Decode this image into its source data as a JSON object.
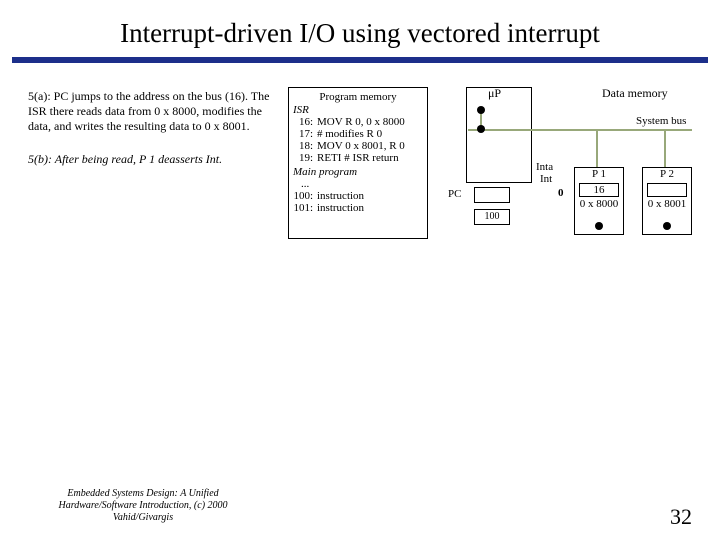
{
  "title": "Interrupt-driven I/O using vectored interrupt",
  "desc": {
    "a": "5(a): PC jumps to the address on the bus (16).  The ISR there reads data from 0 x 8000, modifies the data, and writes the resulting data to 0 x 8001.",
    "b": "5(b): After being read, P 1 deasserts Int."
  },
  "pm": {
    "title": "Program memory",
    "isr": "ISR",
    "l16n": "16:",
    "l16": "MOV R 0, 0 x 8000",
    "l17n": "17:",
    "l17": "# modifies R 0",
    "l18n": "18:",
    "l18": "MOV 0 x 8001, R 0",
    "l19n": "19:",
    "l19": "RETI  # ISR return",
    "main": "Main program",
    "dots": "...",
    "l100n": "100:",
    "l100": "instruction",
    "l101n": "101:",
    "l101": "instruction"
  },
  "labels": {
    "up": "μP",
    "dm": "Data memory",
    "sys": "System bus",
    "inta": "Inta",
    "int": "Int",
    "pc": "PC",
    "zero": "0",
    "p1": "P 1",
    "p2": "P 2",
    "p1v": "16",
    "p2v": "",
    "p1a": "0 x 8000",
    "p2a": "0 x 8001",
    "pc100": "100"
  },
  "footer": "Embedded Systems Design: A Unified Hardware/Software Introduction, (c) 2000 Vahid/Givargis",
  "page": "32"
}
